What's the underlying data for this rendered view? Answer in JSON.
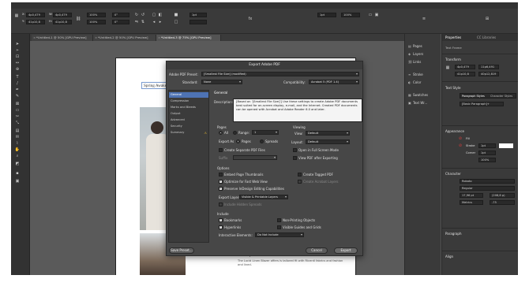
{
  "control_bar": {
    "x_value": "4p0,479",
    "y_value": "41p10,8",
    "w_value": "4p0,479",
    "h_value": "41p10,8",
    "scale_x": "100%",
    "scale_y": "100%",
    "rotate": "0°",
    "shear": "0°",
    "stroke_weight": "1pt",
    "stroke_style": "1pt",
    "opacity": "100%"
  },
  "tabs": [
    {
      "label": "*Untitled-1 @ 50% [GPU Preview]"
    },
    {
      "label": "*Untitled-2 @ 50% [GPU Preview]"
    },
    {
      "label": "*Untitled-3 @ 75% [GPU Preview]"
    }
  ],
  "document": {
    "header_text": "Spring Awakening",
    "description_heading": "Description:",
    "description_text": "The Lucid Linen Blazer offers is tailored fit with Ricerdi fabrics and fashion and lined."
  },
  "dock": {
    "items": [
      {
        "icon": "pages-icon",
        "label": "Pages"
      },
      {
        "icon": "layers-icon",
        "label": "Layers"
      },
      {
        "icon": "links-icon",
        "label": "Links"
      },
      {
        "icon": "stroke-icon",
        "label": "Stroke"
      },
      {
        "icon": "color-icon",
        "label": "Color"
      },
      {
        "icon": "swatches-icon",
        "label": "Swatches"
      },
      {
        "icon": "text-wrap-icon",
        "label": "Text Wr..."
      }
    ]
  },
  "properties": {
    "tab_properties": "Properties",
    "tab_cc_libraries": "CC Libraries",
    "text_frame": "Text Frame",
    "transform": "Transform",
    "tx": "4p0,479",
    "ty": "41p10,8",
    "tw": "11p6,491",
    "th": "40p12,819",
    "text_style": "Text Style",
    "paragraph_styles": "Paragraph Styles",
    "character_styles": "Character Styles",
    "basic_paragraph": "[Basic Paragraph]+",
    "appearance": "Appearance",
    "fill": "Fill",
    "stroke": "Stroke",
    "corner": "Corner",
    "stroke_value": "1pt",
    "corner_value": "1pt",
    "opacity_value": "100%",
    "character": "Character",
    "font_family": "Roboto",
    "font_style": "Regular",
    "font_size": "17,96 pt",
    "leading": "(208,8 p)",
    "kerning": "Metrics",
    "tracking": "-75",
    "paragraph": "Paragraph",
    "align": "Align"
  },
  "dialog": {
    "title": "Export Adobe PDF",
    "preset_label": "Adobe PDF Preset:",
    "preset_value": "[Smallest File Size] (modified)",
    "standard_label": "Standard:",
    "standard_value": "None",
    "compat_label": "Compatibility:",
    "compat_value": "Acrobat 5 (PDF 1.4)",
    "categories": [
      "General",
      "Compression",
      "Marks and Bleeds",
      "Output",
      "Advanced",
      "Security",
      "Summary"
    ],
    "section_general": "General",
    "description_label": "Description:",
    "description_text": "[Based on '[Smallest File Size]'] Use these settings to create Adobe PDF documents best suited for on-screen display, e-mail, and the Internet. Created PDF documents can be opened with Acrobat and Adobe Reader 6.0 and later.",
    "pages_label": "Pages",
    "all_label": "All",
    "range_label": "Range:",
    "range_value": "1",
    "export_as_label": "Export As",
    "pages_radio": "Pages",
    "spreads_radio": "Spreads",
    "separate_pdf": "Create Separate PDF Files",
    "suffix_label": "Suffix",
    "viewing_label": "Viewing",
    "view_label": "View:",
    "view_value": "Default",
    "layout_label": "Layout:",
    "layout_value": "Default",
    "full_screen": "Open in Full Screen Mode",
    "view_after": "View PDF after Exporting",
    "options_label": "Options",
    "embed_thumbs": "Embed Page Thumbnails",
    "optimize_web": "Optimize for Fast Web View",
    "preserve_editing": "Preserve InDesign Editing Capabilities",
    "create_tagged": "Create Tagged PDF",
    "create_layers": "Create Acrobat Layers",
    "export_layers_label": "Export Layers:",
    "export_layers_value": "Visible & Printable Layers",
    "hidden_spreads": "Include Hidden Spreads",
    "include_label": "Include",
    "bookmarks": "Bookmarks",
    "hyperlinks": "Hyperlinks",
    "nonprinting": "Non-Printing Objects",
    "visible_guides": "Visible Guides and Grids",
    "interactive_label": "Interactive Elements:",
    "interactive_value": "Do Not Include",
    "save_preset": "Save Preset...",
    "cancel": "Cancel",
    "export": "Export"
  }
}
